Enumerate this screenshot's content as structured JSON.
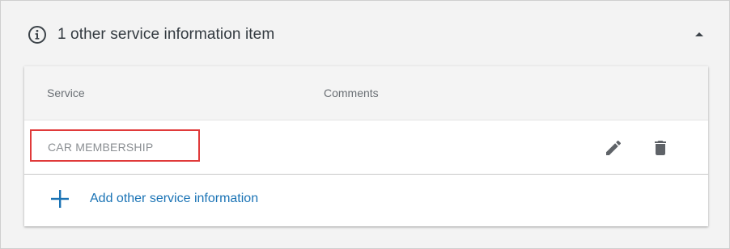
{
  "header": {
    "title": "1 other service information item",
    "info_icon": "info-circle-icon",
    "toggle_icon": "caret-up-icon"
  },
  "table": {
    "columns": [
      "Service",
      "Comments"
    ],
    "rows": [
      {
        "service": "CAR MEMBERSHIP",
        "comments": ""
      }
    ],
    "row_actions": [
      "edit-pencil-icon",
      "delete-trash-icon"
    ]
  },
  "add_action": {
    "label": "Add other service information",
    "icon": "plus-icon"
  },
  "colors": {
    "background": "#f3f3f3",
    "link": "#1a73b5",
    "highlight_border": "#e03a3a",
    "icon": "#5f6368"
  }
}
